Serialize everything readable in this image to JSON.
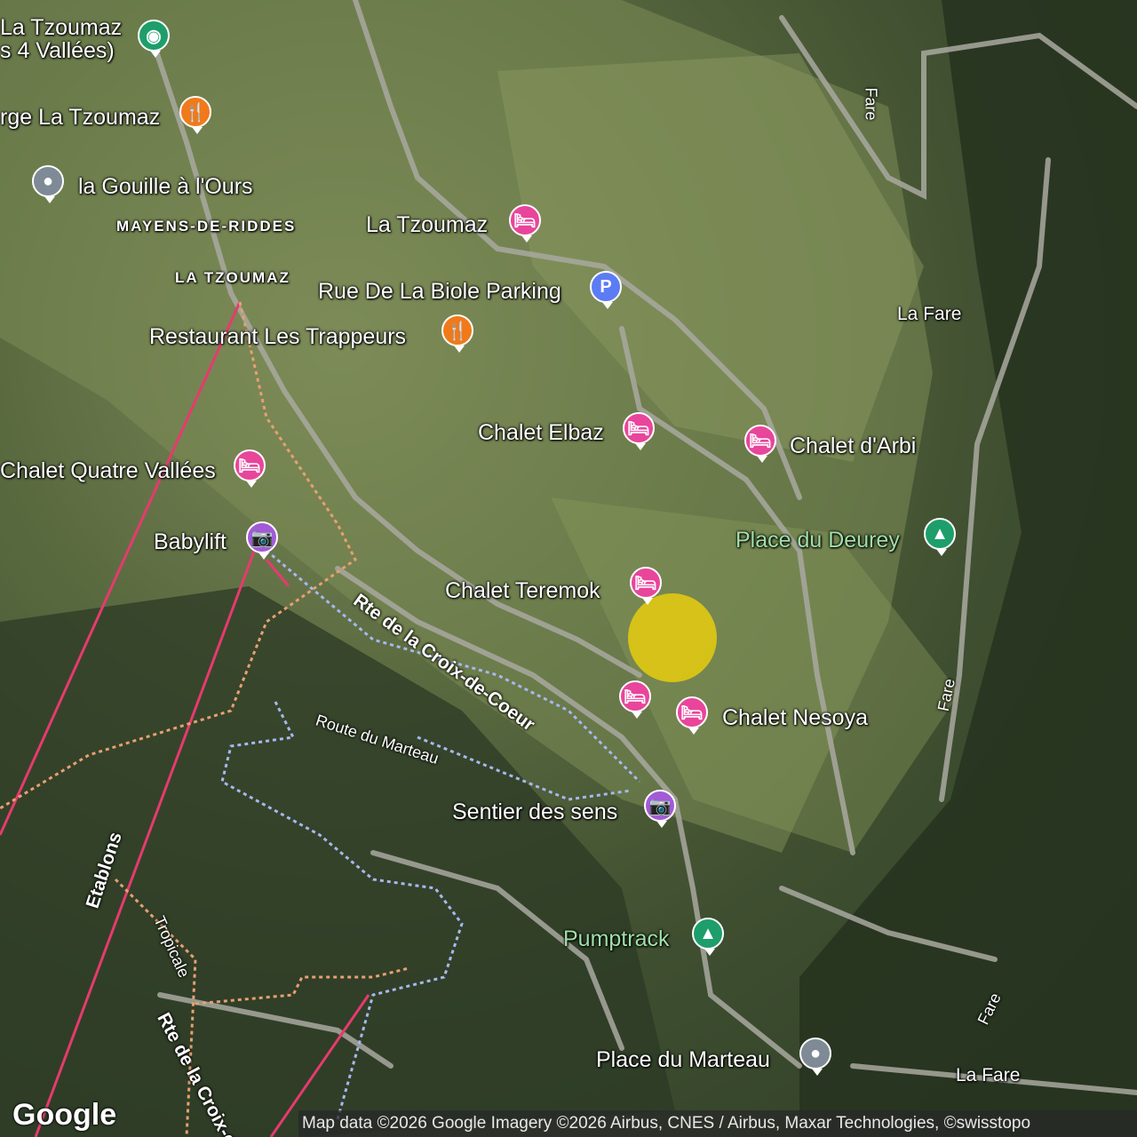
{
  "map": {
    "places": [
      {
        "id": "tzoumaz-top",
        "text": "La Tzoumaz\n(s 4 Vallées)"
      },
      {
        "id": "auberge",
        "text": "rge La Tzoumaz"
      },
      {
        "id": "gouille",
        "text": "la Gouille à l'Ours"
      },
      {
        "id": "mayens",
        "text": "MAYENS-DE-RIDDES"
      },
      {
        "id": "latzoumaz-caps",
        "text": "LA TZOUMAZ"
      },
      {
        "id": "latzoumaz-hotel",
        "text": "La Tzoumaz"
      },
      {
        "id": "parking",
        "text": "Rue De La Biole Parking"
      },
      {
        "id": "trappeurs",
        "text": "Restaurant Les Trappeurs"
      },
      {
        "id": "elbaz",
        "text": "Chalet Elbaz"
      },
      {
        "id": "arbi",
        "text": "Chalet d'Arbi"
      },
      {
        "id": "quatre",
        "text": "Chalet Quatre Vallées"
      },
      {
        "id": "babylift",
        "text": "Babylift"
      },
      {
        "id": "deurey",
        "text": "Place du Deurey"
      },
      {
        "id": "teremok",
        "text": "Chalet Teremok"
      },
      {
        "id": "nesoya",
        "text": "Chalet Nesoya"
      },
      {
        "id": "sentier",
        "text": "Sentier des sens"
      },
      {
        "id": "pumptrack",
        "text": "Pumptrack"
      },
      {
        "id": "marteau-place",
        "text": "Place du Marteau"
      },
      {
        "id": "lafare1",
        "text": "La Fare"
      },
      {
        "id": "lafare2",
        "text": "La Fare"
      }
    ],
    "roads": {
      "croix1": "Rte de la Croix-de-Coeur",
      "croix2": "Rte de la Croix-de-C",
      "marteau": "Route du Marteau",
      "etablons": "Etablons",
      "tropicale": "Tropicale",
      "fare1": "Fare",
      "fare2": "Fare",
      "fare3": "Fare"
    },
    "icons": {
      "restaurant": "fork-knife-icon",
      "hotel": "bed-icon",
      "parking": "P",
      "camera": "camera-icon",
      "park": "tree-icon",
      "poi": "dot-icon",
      "station": "station-icon"
    },
    "colors": {
      "green": "#1e9e6a",
      "orange": "#f07a1a",
      "pink": "#e8459b",
      "blue": "#5b7cf5",
      "purple": "#a35ad6",
      "gray": "#7e8a95",
      "highlight": "#ffd800"
    }
  },
  "footer": {
    "logo": "Google",
    "attribution": "Map data ©2026 Google Imagery ©2026 Airbus, CNES / Airbus, Maxar Technologies, ©swisstopo"
  }
}
